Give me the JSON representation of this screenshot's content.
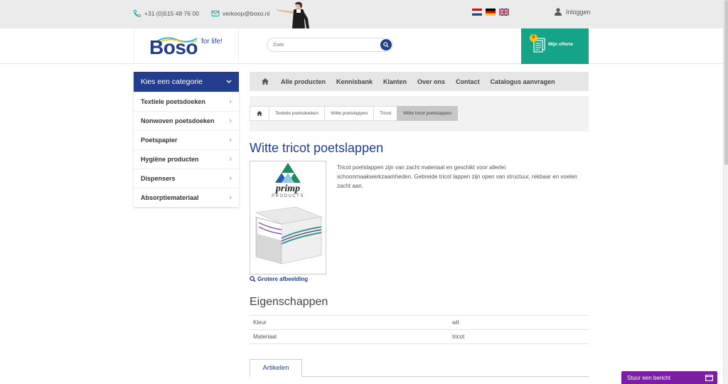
{
  "topbar": {
    "phone": "+31 (0)515 48 76 00",
    "email": "verkoop@boso.nl",
    "login_label": "Inloggen",
    "flags": [
      "nl-flag-icon",
      "de-flag-icon",
      "uk-flag-icon"
    ]
  },
  "header": {
    "logo_text": "Boso",
    "logo_tagline": "for life!",
    "search_placeholder": "Zoek",
    "quote": {
      "count": "0",
      "label": "Mijn offerte"
    }
  },
  "categories": {
    "title": "Kies een categorie",
    "items": [
      "Textiele poetsdoeken",
      "Nonwoven poetsdoeken",
      "Poetspapier",
      "Hygiëne producten",
      "Dispensers",
      "Absorptiemateriaal"
    ]
  },
  "nav": {
    "items": [
      "Alle producten",
      "Kennisbank",
      "Klanten",
      "Over ons",
      "Contact",
      "Catalogus aanvragen"
    ]
  },
  "breadcrumb": [
    "Textiele poetsdoeken",
    "Witte poetslappen",
    "Tricot",
    "Witte tricot poetslappen"
  ],
  "product": {
    "title": "Witte tricot poetslappen",
    "description": "Tricot poetslappen zijn van zacht materiaal en geschikt voor allerlei schoonmaakwerkzaamheden. Gebreide tricot lappen zijn open van structuur, rekbaar en voelen zacht aan.",
    "image_brand": "primp",
    "image_brand_sub": "PRODUCTS",
    "larger_image_label": "Grotere afbeelding"
  },
  "properties": {
    "title": "Eigenschappen",
    "rows": [
      {
        "label": "Kleur",
        "value": "wit"
      },
      {
        "label": "Materiaal",
        "value": "tricot"
      }
    ]
  },
  "tabs": [
    "Artikelen"
  ],
  "chat": {
    "label": "Stuur een bericht"
  },
  "colors": {
    "brand_blue": "#233e8e",
    "quote_green": "#16a489",
    "chat_purple": "#7b1fa2",
    "badge_yellow": "#f3c21b"
  }
}
